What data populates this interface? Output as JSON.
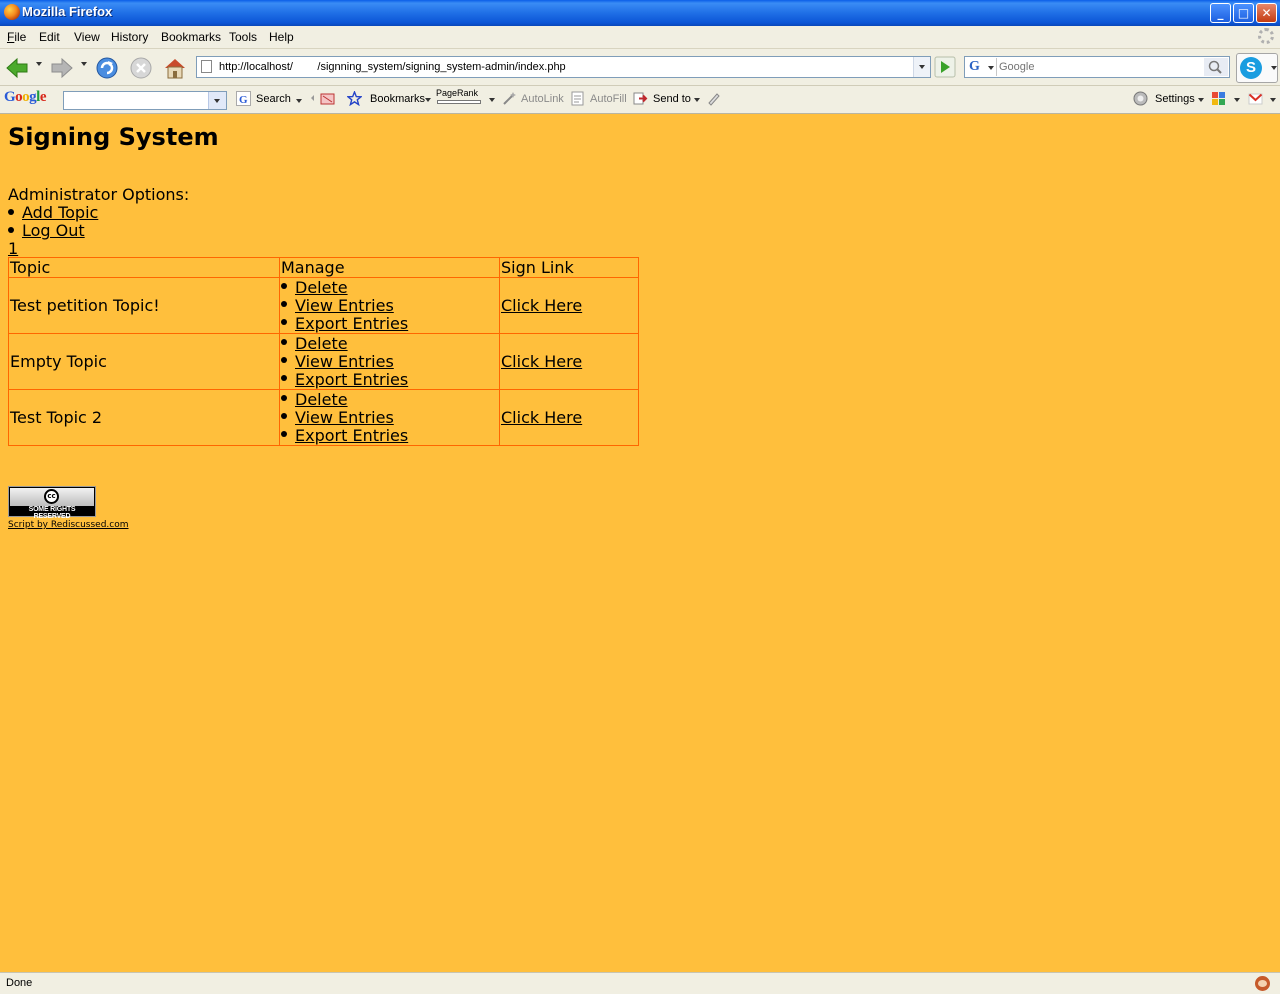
{
  "window": {
    "title": "Mozilla Firefox",
    "minimize": "_",
    "maximize": "□",
    "close": "✕"
  },
  "menu": [
    "File",
    "Edit",
    "View",
    "History",
    "Bookmarks",
    "Tools",
    "Help"
  ],
  "menu_accel": [
    "F",
    "E",
    "V",
    "H",
    "B",
    "T",
    "H"
  ],
  "nav": {
    "url": "http://localhost/        /signning_system/signing_system-admin/index.php",
    "search_engine_letter": "G",
    "search_placeholder": "Google"
  },
  "google_toolbar": {
    "logo_letters": [
      "G",
      "o",
      "o",
      "g",
      "l",
      "e"
    ],
    "logo_colors": [
      "#2a5bd7",
      "#d8291c",
      "#f0b000",
      "#2a5bd7",
      "#1e9d3a",
      "#d8291c"
    ],
    "search_label": "Search",
    "bookmarks_label": "Bookmarks",
    "pagerank_label": "PageRank",
    "autolink_label": "AutoLink",
    "autofill_label": "AutoFill",
    "sendto_label": "Send to",
    "settings_label": "Settings"
  },
  "page": {
    "title": "Signing System",
    "admin_label": "Administrator Options:",
    "admin_options": [
      "Add Topic",
      "Log Out"
    ],
    "page_number": "1",
    "table": {
      "headers": [
        "Topic",
        "Manage",
        "Sign Link"
      ],
      "rows": [
        {
          "topic": "Test petition Topic!",
          "actions": [
            "Delete",
            "View Entries",
            "Export Entries"
          ],
          "sign_link": "Click Here"
        },
        {
          "topic": "Empty Topic",
          "actions": [
            "Delete",
            "View Entries",
            "Export Entries"
          ],
          "sign_link": "Click Here"
        },
        {
          "topic": "Test Topic 2",
          "actions": [
            "Delete",
            "View Entries",
            "Export Entries"
          ],
          "sign_link": "Click Here"
        }
      ]
    },
    "cc_badge_text": "SOME RIGHTS RESERVED",
    "cc_symbol": "cc",
    "credit": "Script by Rediscussed.com"
  },
  "status": {
    "text": "Done"
  },
  "colors": {
    "page_background": "#ffbf3c",
    "table_border": "#ff6600",
    "chrome": "#f1efe2"
  }
}
